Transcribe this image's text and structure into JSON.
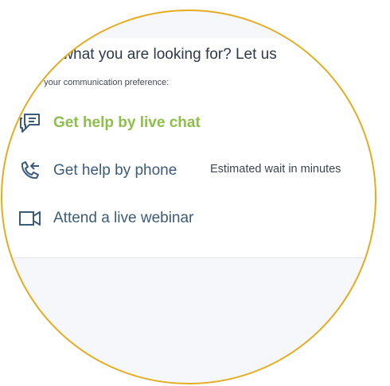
{
  "header": {
    "headline": "nd what you are looking for? Let us",
    "subline": "e your communication preference:"
  },
  "options": [
    {
      "label": "Get help by live chat",
      "icon": "chat-bubble-icon",
      "color": "#8dc04a"
    },
    {
      "label": "Get help by phone",
      "icon": "phone-icon",
      "color": "#3b5b79"
    },
    {
      "label": "Attend a live webinar",
      "icon": "video-camera-icon",
      "color": "#3b5b79"
    }
  ],
  "phone_wait_text": "Estimated wait in minutes",
  "colors": {
    "ring": "#e6ac1f",
    "accent_green": "#8dc04a",
    "text_blue": "#3b5b79",
    "panel_gray": "#f5f7fa"
  }
}
